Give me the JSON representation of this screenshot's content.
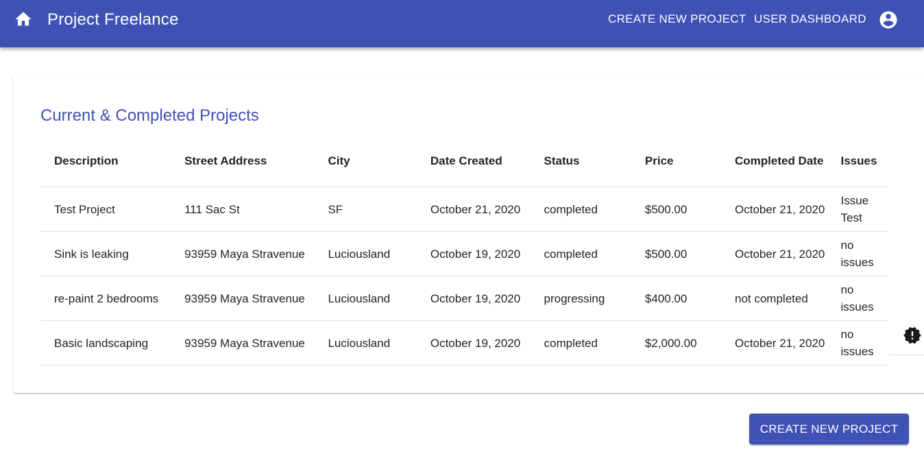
{
  "appbar": {
    "title": "Project Freelance",
    "home_icon": "home-icon",
    "account_icon": "account-circle-icon",
    "nav": {
      "create_label": "CREATE NEW PROJECT",
      "dashboard_label": "USER DASHBOARD"
    },
    "color": "#3f51b5"
  },
  "card": {
    "title": "Current & Completed Projects"
  },
  "table": {
    "columns": [
      "Description",
      "Street Address",
      "City",
      "Date Created",
      "Status",
      "Price",
      "Completed Date",
      "Issues"
    ],
    "rows": [
      [
        "Test Project",
        "111 Sac St",
        "SF",
        "October 21, 2020",
        "completed",
        "$500.00",
        "October 21, 2020",
        "Issue Test"
      ],
      [
        "Sink is leaking",
        "93959 Maya Stravenue",
        "Luciousland",
        "October 19, 2020",
        "completed",
        "$500.00",
        "October 21, 2020",
        "no issues"
      ],
      [
        "re-paint 2 bedrooms",
        "93959 Maya Stravenue",
        "Luciousland",
        "October 19, 2020",
        "progressing",
        "$400.00",
        "not completed",
        "no issues"
      ],
      [
        "Basic landscaping",
        "93959 Maya Stravenue",
        "Luciousland",
        "October 19, 2020",
        "completed",
        "$2,000.00",
        "October 21, 2020",
        "no issues"
      ]
    ]
  },
  "alert_icon": "alert-badge-icon",
  "footer": {
    "create_button_label": "CREATE NEW PROJECT"
  }
}
